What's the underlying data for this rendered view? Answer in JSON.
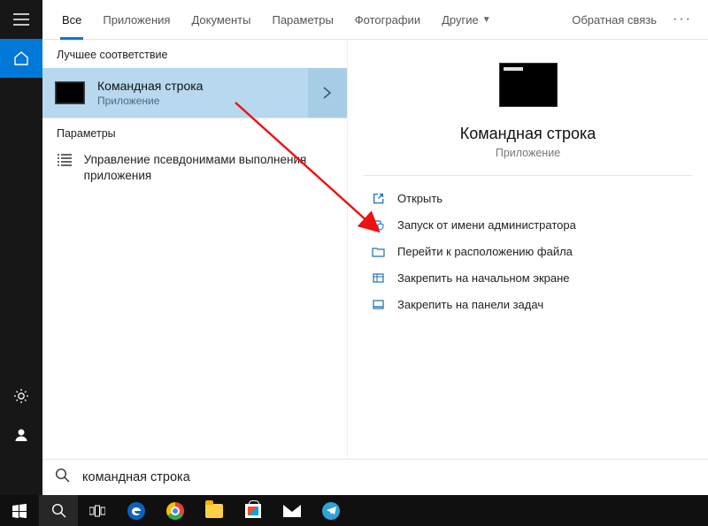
{
  "tabs": {
    "all": "Все",
    "apps": "Приложения",
    "docs": "Документы",
    "settings": "Параметры",
    "photos": "Фотографии",
    "other": "Другие"
  },
  "feedback_label": "Обратная связь",
  "sections": {
    "best_match": "Лучшее соответствие",
    "settings": "Параметры"
  },
  "best": {
    "title": "Командная строка",
    "subtitle": "Приложение"
  },
  "settings_item": "Управление псевдонимами выполнения приложения",
  "detail": {
    "title": "Командная строка",
    "subtitle": "Приложение"
  },
  "actions": {
    "open": "Открыть",
    "admin": "Запуск от имени администратора",
    "file_location": "Перейти к расположению файла",
    "pin_start": "Закрепить на начальном экране",
    "pin_taskbar": "Закрепить на панели задач"
  },
  "search": {
    "value": "командная строка"
  },
  "sidebar_icons": {
    "menu": "menu-icon",
    "home": "home-icon",
    "settings": "gear-icon",
    "account": "person-icon"
  },
  "taskbar_icons": [
    "start",
    "search",
    "taskview",
    "edge",
    "chrome",
    "explorer",
    "store",
    "mail",
    "telegram"
  ]
}
